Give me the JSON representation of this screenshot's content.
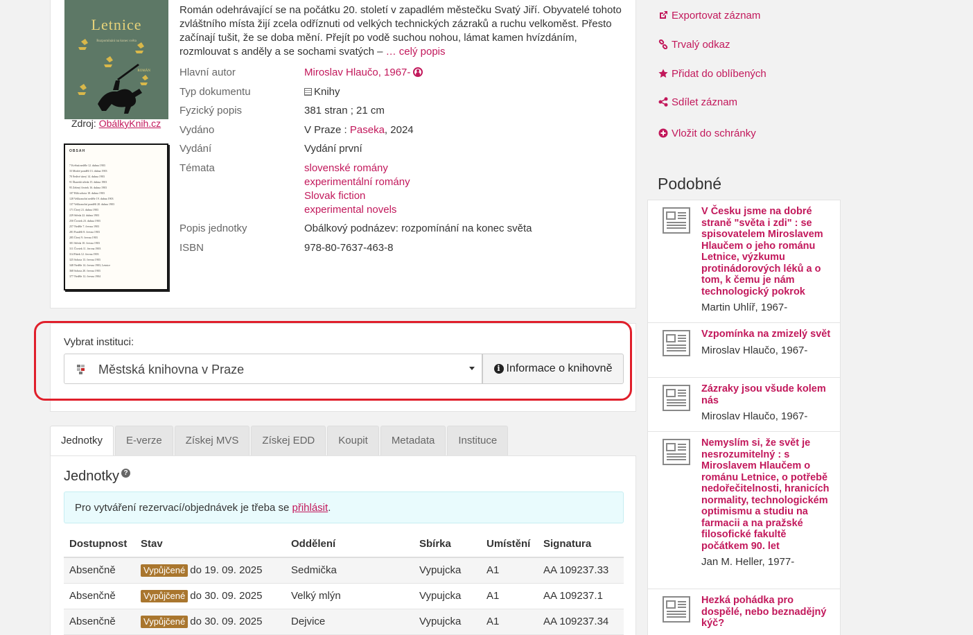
{
  "record": {
    "cover": {
      "title": "Letnice",
      "subtitle": "Rozpomínání na konec světa",
      "publisher_mark": "ROMÁN",
      "source_label": "Zdroj:",
      "source_link": "ObálkyKnih.cz"
    },
    "toc": {
      "heading": "OBSAH",
      "rows": [
        "7 Květná neděle 12. dubna 1903",
        "33 Modré pondělí 13. dubna 1903",
        "70 Šedivé úterý 14. dubna 1903",
        "91 Škaredá středa 15. dubna 1903",
        "95 Zelený čtvrtek 16. dubna 1903",
        "107 Bílá sobota 18. dubna 1903",
        "128 Velikonoční neděle 19. dubna 1903",
        "137 Velikonoční pondělí 20. dubna 1903",
        "171 Úterý 21. dubna 1903",
        "229 Středa 22. dubna 1903",
        "250 Čtvrtek 23. dubna 1903",
        "257 Neděle 7. června 1903",
        "281 Pondělí 8. června 1903",
        "285 Úterý 9. června 1903",
        "301 Středa 10. června 1903",
        "311 Čtvrtek 11. června 1903",
        "314 Pátek 12. června 1903",
        "325 Sobota 13. června 1903",
        "348 Neděle 14. června 1903, Letnice",
        "368 Sobota 20. června 1903",
        "377 Neděle 12. června 1904"
      ]
    },
    "description": "Román odehrávající se na počátku 20. století v zapadlém městečku Svatý Jiří. Obyvatelé tohoto zvláštního místa žijí zcela odříznuti od velkých technických zázraků a ruchu velkoměst. Přesto začínají tušit, že se doba mění. Přejít po vodě suchou nohou, lámat kamen hvízdáním, rozmlouvat s anděly a se sochami svatých –",
    "description_more": "… celý popis",
    "fields": {
      "author_label": "Hlavní autor",
      "author_value": "Miroslav Hlaučo, 1967-",
      "doctype_label": "Typ dokumentu",
      "doctype_value": "Knihy",
      "physical_label": "Fyzický popis",
      "physical_value": "381 stran ; 21 cm",
      "published_label": "Vydáno",
      "published_place": "V Praze :",
      "published_publisher": "Paseka",
      "published_year": ", 2024",
      "edition_label": "Vydání",
      "edition_value": "Vydání první",
      "topics_label": "Témata",
      "topics": [
        "slovenské romány",
        "experimentální romány",
        "Slovak fiction",
        "experimental novels"
      ],
      "unit_label": "Popis jednotky",
      "unit_value": "Obálkový podnázev: rozpomínání na konec světa",
      "isbn_label": "ISBN",
      "isbn_value": "978-80-7637-463-8"
    }
  },
  "institution": {
    "label": "Vybrat instituci:",
    "selected": "Městská knihovna v Praze",
    "info_button": "Informace o knihovně"
  },
  "tabs": [
    "Jednotky",
    "E-verze",
    "Získej MVS",
    "Získej EDD",
    "Koupit",
    "Metadata",
    "Instituce"
  ],
  "holdings": {
    "title": "Jednotky",
    "alert_text": "Pro vytváření rezervací/objednávek je třeba se",
    "alert_link": "přihlásit",
    "alert_end": ".",
    "columns": [
      "Dostupnost",
      "Stav",
      "Oddělení",
      "Sbírka",
      "Umístění",
      "Signatura"
    ],
    "rows": [
      {
        "availability": "Absenčně",
        "badge": "Vypůjčené",
        "due": "do 19. 09. 2025",
        "department": "Sedmička",
        "collection": "Vypujcka",
        "location": "A1",
        "signature": "AA 109237.33"
      },
      {
        "availability": "Absenčně",
        "badge": "Vypůjčené",
        "due": "do 30. 09. 2025",
        "department": "Velký mlýn",
        "collection": "Vypujcka",
        "location": "A1",
        "signature": "AA 109237.1"
      },
      {
        "availability": "Absenčně",
        "badge": "Vypůjčené",
        "due": "do 30. 09. 2025",
        "department": "Dejvice",
        "collection": "Vypujcka",
        "location": "A1",
        "signature": "AA 109237.34"
      }
    ]
  },
  "sidebar": {
    "actions": [
      "Exportovat záznam",
      "Trvalý odkaz",
      "Přidat do oblíbených",
      "Sdílet záznam",
      "Vložit do schránky"
    ],
    "similar_title": "Podobné",
    "similar": [
      {
        "title": "V Česku jsme na dobré straně \"světa i zdi\" : se spisovatelem Miroslavem Hlaučem o jeho románu Letnice, výzkumu protinádorových léků a o tom, k čemu je nám technologický pokrok",
        "author": "Martin Uhlíř, 1967-"
      },
      {
        "title": "Vzpomínka na zmizelý svět",
        "author": "Miroslav Hlaučo, 1967-"
      },
      {
        "title": "Zázraky jsou všude kolem nás",
        "author": "Miroslav Hlaučo, 1967-"
      },
      {
        "title": "Nemyslím si, že svět je nesrozumitelný : s Miroslavem Hlaučem o románu Letnice, o potřebě nedořečitelnosti, hranicích normality, technologickém optimismu a studiu na farmacii a na pražské filosofické fakultě počátkem 90. let",
        "author": "Jan M. Heller, 1977-"
      },
      {
        "title": "Hezká pohádka pro dospělé, nebo beznadějný kýč?",
        "author": ""
      }
    ]
  },
  "colors": {
    "accent": "#c2185b",
    "badge": "#a9762e",
    "highlight": "#e01f2b"
  }
}
